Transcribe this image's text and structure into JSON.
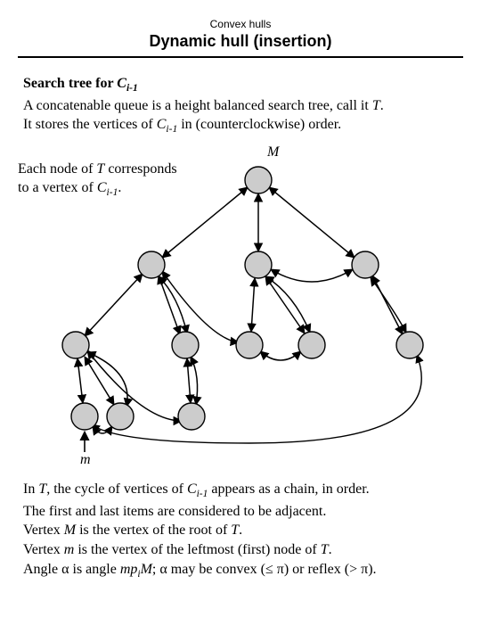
{
  "header": {
    "topic": "Convex hulls",
    "title": "Dynamic hull (insertion)"
  },
  "intro": {
    "heading_prefix": "Search tree for ",
    "heading_var": "C",
    "heading_sub": "i-1",
    "line1_a": "A concatenable queue is a height balanced search tree, call it ",
    "line1_t": "T",
    "line1_b": ".",
    "line2_a": "It stores the vertices of ",
    "line2_b": " in (counterclockwise) order."
  },
  "diagram": {
    "caption_a": "Each node of ",
    "caption_t": "T",
    "caption_b": " corresponds to a vertex of ",
    "caption_c": ".",
    "label_M": "M",
    "label_m": "m"
  },
  "footer": {
    "l1_a": "In ",
    "l1_t": "T",
    "l1_b": ", the cycle of vertices of ",
    "l1_c": " appears as a chain, in order.",
    "l2": "The first and last items are considered to be adjacent.",
    "l3_a": "Vertex ",
    "l3_M": "M",
    "l3_b": " is the vertex of the root of ",
    "l3_t": "T",
    "l3_c": ".",
    "l4_a": "Vertex ",
    "l4_m": "m",
    "l4_b": " is the vertex of the leftmost (first) node of ",
    "l4_t": "T",
    "l4_c": ".",
    "l5_a": "Angle ",
    "l5_alpha1": "α",
    "l5_b": " is angle ",
    "l5_mpM_m": "m",
    "l5_mpM_p": "p",
    "l5_mpM_i": "i",
    "l5_mpM_M": "M",
    "l5_c": "; ",
    "l5_alpha2": "α",
    "l5_d": " may be convex (≤ ",
    "l5_pi1": "π",
    "l5_e": ") or reflex (> ",
    "l5_pi2": "π",
    "l5_f": ")."
  }
}
